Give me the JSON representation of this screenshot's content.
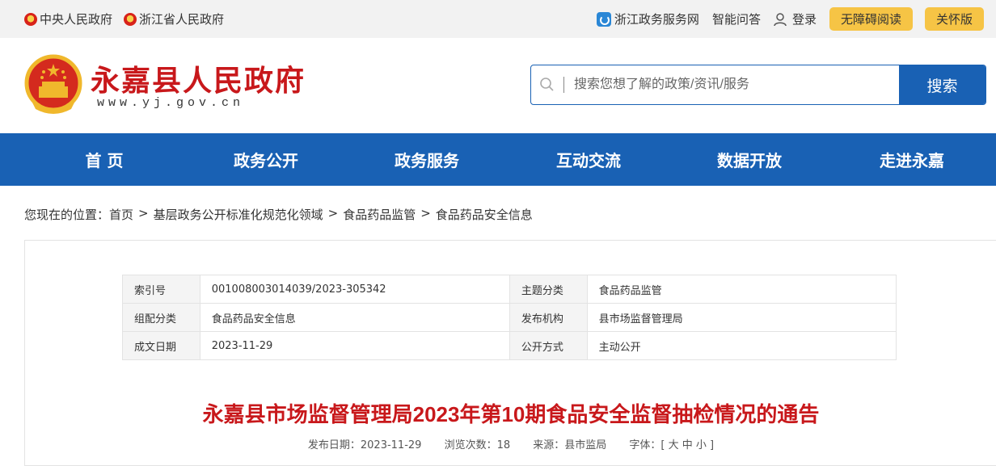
{
  "topbar": {
    "links_left": [
      "中央人民政府",
      "浙江省人民政府"
    ],
    "zjzwfw": "浙江政务服务网",
    "ask": "智能问答",
    "login": "登录",
    "accessible": "无障碍阅读",
    "elderly": "关怀版"
  },
  "header": {
    "site_title": "永嘉县人民政府",
    "site_url": "www.yj.gov.cn",
    "search_placeholder": "搜索您想了解的政策/资讯/服务",
    "search_button": "搜索"
  },
  "nav": [
    "首 页",
    "政务公开",
    "政务服务",
    "互动交流",
    "数据开放",
    "走进永嘉"
  ],
  "breadcrumb": {
    "prefix": "您现在的位置：",
    "items": [
      "首页",
      "基层政务公开标准化规范化领域",
      "食品药品监管",
      "食品药品安全信息"
    ],
    "separator": ">"
  },
  "meta_table": [
    {
      "k1": "索引号",
      "v1": "001008003014039/2023-305342",
      "k2": "主题分类",
      "v2": "食品药品监管"
    },
    {
      "k1": "组配分类",
      "v1": "食品药品安全信息",
      "k2": "发布机构",
      "v2": "县市场监督管理局"
    },
    {
      "k1": "成文日期",
      "v1": "2023-11-29",
      "k2": "公开方式",
      "v2": "主动公开"
    }
  ],
  "article": {
    "title": "永嘉县市场监督管理局2023年第10期食品安全监督抽检情况的通告",
    "publish_date": "发布日期：2023-11-29",
    "views": "浏览次数：18",
    "source": "来源：县市监局",
    "font_size": "字体：[ 大 中 小 ]"
  },
  "colors": {
    "brand_blue": "#1961b4",
    "title_red": "#c8181b",
    "pill_yellow": "#f6c445"
  }
}
